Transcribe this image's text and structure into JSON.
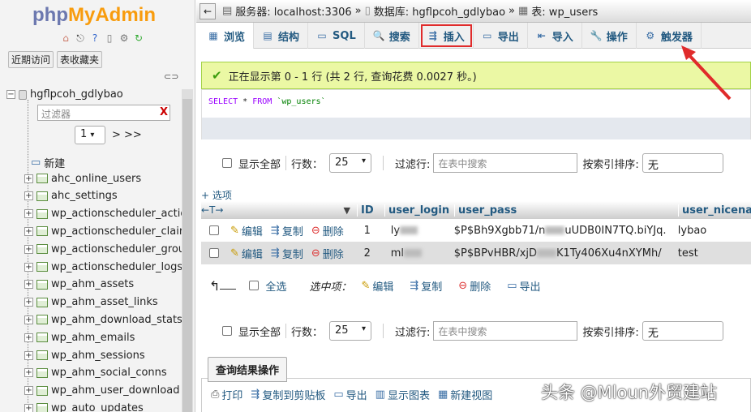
{
  "sidebar": {
    "logo_php": "php",
    "logo_myadmin": "MyAdmin",
    "tabs": [
      "近期访问",
      "表收藏夹"
    ],
    "db_name": "hgflpcoh_gdlybao",
    "filter_placeholder": "过滤器",
    "filter_clear": "X",
    "page_value": "1",
    "page_next": "> >>",
    "new_label": "新建",
    "tables": [
      "ahc_online_users",
      "ahc_settings",
      "wp_actionscheduler_actio",
      "wp_actionscheduler_clair",
      "wp_actionscheduler_grou",
      "wp_actionscheduler_logs",
      "wp_ahm_assets",
      "wp_ahm_asset_links",
      "wp_ahm_download_stats",
      "wp_ahm_emails",
      "wp_ahm_sessions",
      "wp_ahm_social_conns",
      "wp_ahm_user_download",
      "wp_auto_updates"
    ]
  },
  "breadcrumb": {
    "server": "服务器: localhost:3306",
    "database": "数据库: hgflpcoh_gdlybao",
    "table": "表: wp_users",
    "sep": "»"
  },
  "tabs": [
    {
      "label": "浏览",
      "icon": "browse-icon",
      "glyph": "▦"
    },
    {
      "label": "结构",
      "icon": "structure-icon",
      "glyph": "▤"
    },
    {
      "label": "SQL",
      "icon": "sql-icon",
      "glyph": "▭"
    },
    {
      "label": "搜索",
      "icon": "search-icon",
      "glyph": "🔍"
    },
    {
      "label": "插入",
      "icon": "insert-icon",
      "glyph": "⇶"
    },
    {
      "label": "导出",
      "icon": "export-icon",
      "glyph": "▭"
    },
    {
      "label": "导入",
      "icon": "import-icon",
      "glyph": "⇤"
    },
    {
      "label": "操作",
      "icon": "wrench-icon",
      "glyph": "🔧"
    },
    {
      "label": "触发器",
      "icon": "trigger-icon",
      "glyph": "⚙"
    }
  ],
  "success_message": "正在显示第 0 - 1 行 (共 2 行, 查询花费 0.0027 秒。)",
  "sql": {
    "select": "SELECT",
    "star": "*",
    "from": "FROM",
    "table": "`wp_users`"
  },
  "nav": {
    "show_all": "显示全部",
    "rows_label": "行数：",
    "rows_value": "25",
    "filter_label": "过滤行:",
    "filter_placeholder": "在表中搜索",
    "sort_label": "按索引排序:",
    "sort_value": "无"
  },
  "options_label": "+ 选项",
  "columns": [
    "ID",
    "user_login",
    "user_pass",
    "user_nicenam"
  ],
  "row_actions": {
    "edit": "编辑",
    "copy": "复制",
    "delete": "删除"
  },
  "rows": [
    {
      "id": "1",
      "login": "ly",
      "pass_a": "$P$Bh9Xgbb71/n",
      "pass_b": "uUDB0IN7TQ.biYJq.",
      "nicename": "lybao"
    },
    {
      "id": "2",
      "login": "ml",
      "pass_a": "$P$BPvHBR/xjD",
      "pass_b": "K1Ty406Xu4nXYMh/",
      "nicename": "test"
    }
  ],
  "bulk": {
    "check_all": "全选",
    "with_selected": "选中项：",
    "edit": "编辑",
    "copy": "复制",
    "delete": "删除",
    "export": "导出"
  },
  "query_results": {
    "title": "查询结果操作",
    "print": "打印",
    "copy_clipboard": "复制到剪贴板",
    "export": "导出",
    "show_chart": "显示图表",
    "new_view": "新建视图"
  },
  "watermark": "头条 @Mloun外贸建站",
  "colors": {
    "accent": "#235a81",
    "highlight": "#e02b2b",
    "success_bg": "#ebf8a4"
  }
}
